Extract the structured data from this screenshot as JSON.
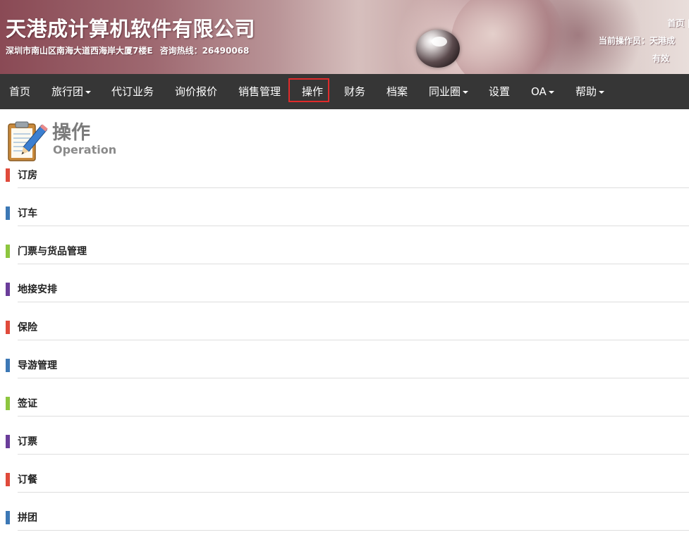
{
  "header": {
    "company_name": "天港成计算机软件有限公司",
    "address": "深圳市南山区南海大道西海岸大厦7楼E",
    "hotline_label": "咨询热线：",
    "hotline": "26490068",
    "home_link": "首页 |",
    "operator_text": "当前操作员：天港成",
    "validity_text": "有效"
  },
  "nav": {
    "items": [
      {
        "label": "首页"
      },
      {
        "label": "旅行团"
      },
      {
        "label": "代订业务"
      },
      {
        "label": "询价报价"
      },
      {
        "label": "销售管理"
      },
      {
        "label": "操作"
      },
      {
        "label": "财务"
      },
      {
        "label": "档案"
      },
      {
        "label": "同业圈"
      },
      {
        "label": "设置"
      },
      {
        "label": "OA"
      },
      {
        "label": "帮助"
      }
    ],
    "active": "操作"
  },
  "page": {
    "title": "操作",
    "subtitle": "Operation",
    "icon": "notepad-pencil-icon"
  },
  "sections": [
    {
      "label": "订房",
      "color": "#e04a3b"
    },
    {
      "label": "订车",
      "color": "#3c78b5"
    },
    {
      "label": "门票与货品管理",
      "color": "#8dc63f"
    },
    {
      "label": "地接安排",
      "color": "#6a3d9a"
    },
    {
      "label": "保险",
      "color": "#e04a3b"
    },
    {
      "label": "导游管理",
      "color": "#3c78b5"
    },
    {
      "label": "签证",
      "color": "#8dc63f"
    },
    {
      "label": "订票",
      "color": "#6a3d9a"
    },
    {
      "label": "订餐",
      "color": "#e04a3b"
    },
    {
      "label": "拼团",
      "color": "#3c78b5"
    }
  ]
}
